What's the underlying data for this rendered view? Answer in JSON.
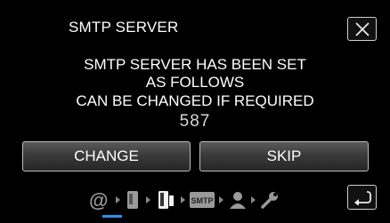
{
  "header": {
    "title": "SMTP SERVER"
  },
  "message": {
    "line1": "SMTP SERVER HAS BEEN SET",
    "line2": "AS FOLLOWS",
    "line3": "CAN BE CHANGED IF REQUIRED",
    "port": "587"
  },
  "buttons": {
    "change": "CHANGE",
    "skip": "SKIP"
  },
  "steps": [
    {
      "icon": "at-icon",
      "label": "@"
    },
    {
      "icon": "phone-icon"
    },
    {
      "icon": "device-icon",
      "active": true
    },
    {
      "icon": "smtp-icon",
      "label": "SMTP"
    },
    {
      "icon": "user-icon"
    },
    {
      "icon": "wrench-icon"
    }
  ],
  "colors": {
    "accent": "#2f8fe8",
    "background": "#000000"
  }
}
